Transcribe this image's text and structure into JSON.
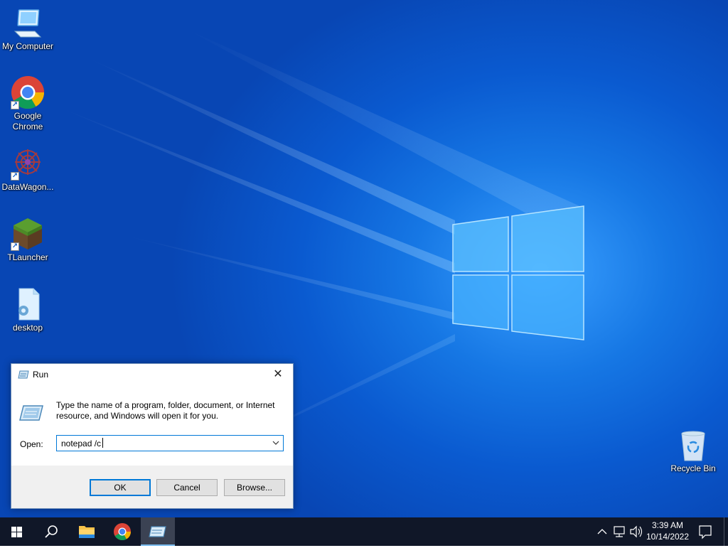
{
  "desktop": {
    "icons": [
      {
        "label": "My Computer",
        "icon": "computer-icon"
      },
      {
        "label": "Google\nChrome",
        "icon": "chrome-icon"
      },
      {
        "label": "DataWagon...",
        "icon": "datawagon-icon"
      },
      {
        "label": "TLauncher",
        "icon": "tlauncher-icon"
      },
      {
        "label": "desktop",
        "icon": "settings-file-icon"
      },
      {
        "label": "Recycle Bin",
        "icon": "recycle-bin-icon"
      }
    ]
  },
  "run_dialog": {
    "title": "Run",
    "description": "Type the name of a program, folder, document, or Internet resource, and Windows will open it for you.",
    "open_label": "Open:",
    "command_value": "notepad /c",
    "ok_label": "OK",
    "cancel_label": "Cancel",
    "browse_label": "Browse...",
    "close_glyph": "✕"
  },
  "taskbar": {
    "time": "3:39 AM",
    "date": "10/14/2022",
    "tray_chevron": "^"
  },
  "colors": {
    "taskbar": "#101728",
    "accent": "#0078d7",
    "desktop_blue": "#0a5ad0"
  }
}
